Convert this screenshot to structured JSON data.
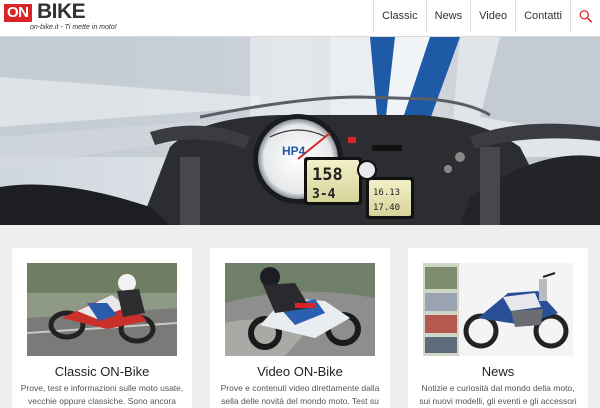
{
  "brand": {
    "logo_on": "ON",
    "logo_bike": "BIKE",
    "tagline": "on-bike.it - Ti mette in moto!"
  },
  "nav": {
    "items": [
      {
        "label": "Classic"
      },
      {
        "label": "News"
      },
      {
        "label": "Video"
      },
      {
        "label": "Contatti"
      }
    ],
    "search_icon": "search-icon"
  },
  "hero": {
    "speed": "158",
    "gear": "3-4",
    "odo_top": "16.13",
    "odo_bottom": "17.40",
    "dash_logo": "HP4"
  },
  "cards": [
    {
      "title": "Classic ON-Bike",
      "desc": "Prove, test e informazioni sulle moto usate, vecchie oppure classiche. Sono ancora"
    },
    {
      "title": "Video ON-Bike",
      "desc": "Prove e contenuti video direttamente dalla sella delle novità del mondo moto. Test su"
    },
    {
      "title": "News",
      "desc": "Notizie e curiosità dal mondo della moto, sui nuovi modelli, gli eventi e gli accessori"
    }
  ],
  "colors": {
    "brand_red": "#d9252a",
    "page_bg": "#eeeeee",
    "text_dark": "#222222"
  }
}
